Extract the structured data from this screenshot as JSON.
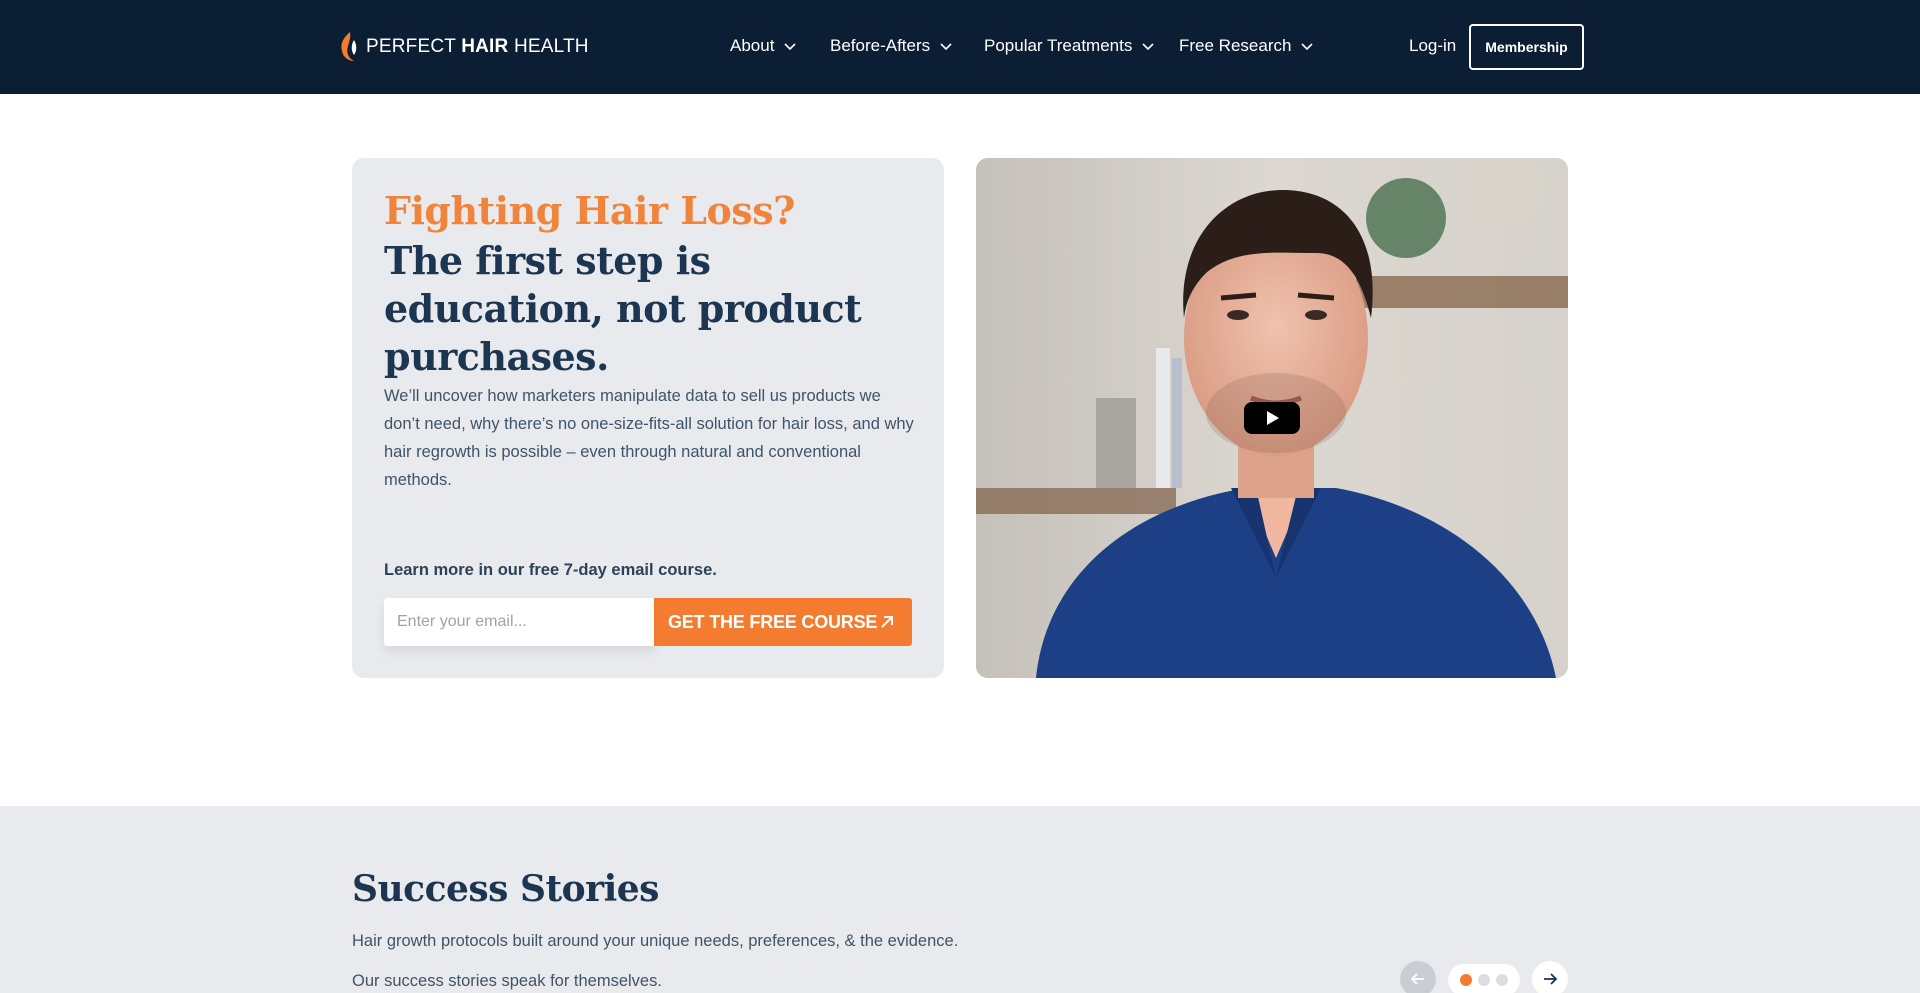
{
  "header": {
    "logo": {
      "word1": "PERFECT ",
      "word2": "HAIR",
      "word3": " HEALTH"
    },
    "nav": [
      {
        "label": "About",
        "icon": "chevron-down-icon"
      },
      {
        "label": "Before-Afters",
        "icon": "chevron-down-icon"
      },
      {
        "label": "Popular Treatments",
        "icon": "chevron-down-icon"
      },
      {
        "label": "Free Research",
        "icon": "chevron-down-icon"
      }
    ],
    "login_label": "Log-in",
    "membership_label": "Membership"
  },
  "hero": {
    "headline_accent": "Fighting Hair Loss?",
    "headline_main": "The first step is education, not product purchases.",
    "body": "We’ll uncover how marketers manipulate data to sell us products we don’t need, why there’s no one-size-fits-all solution for hair loss, and why hair regrowth is possible – even through natural and conventional methods.",
    "course_label": "Learn more in our free 7-day email course.",
    "email_placeholder": "Enter your email...",
    "cta_label": "GET THE FREE COURSE",
    "cta_icon": "arrow-up-right-icon"
  },
  "video": {
    "play_icon": "play-icon"
  },
  "success_stories": {
    "title": "Success Stories",
    "subtitle1": "Hair growth protocols built around your unique needs, preferences, & the evidence.",
    "subtitle2": "Our success stories speak for themselves.",
    "carousel": {
      "active_index": 0,
      "total": 3
    }
  },
  "colors": {
    "nav_bg": "#0b1e33",
    "accent_orange": "#f47c30",
    "heading_navy": "#1c3550",
    "card_bg": "#e8eaee"
  }
}
